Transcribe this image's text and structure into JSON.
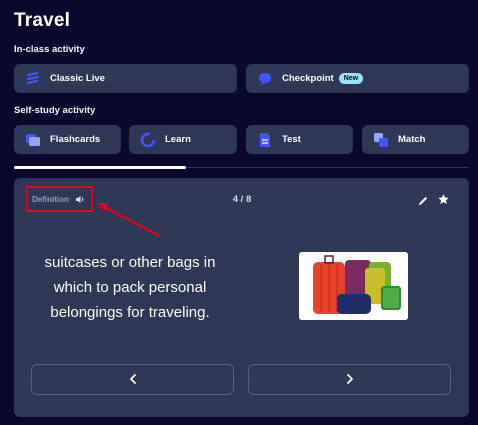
{
  "page": {
    "title": "Travel"
  },
  "sections": {
    "in_class": "In-class activity",
    "self_study": "Self-study activity"
  },
  "in_class_buttons": {
    "classic_live": {
      "label": "Classic Live",
      "icon": "classic-live-icon"
    },
    "checkpoint": {
      "label": "Checkpoint",
      "icon": "checkpoint-icon",
      "badge": "New"
    }
  },
  "self_study_buttons": {
    "flashcards": {
      "label": "Flashcards",
      "icon": "flashcards-icon"
    },
    "learn": {
      "label": "Learn",
      "icon": "learn-icon"
    },
    "test": {
      "label": "Test",
      "icon": "test-icon"
    },
    "match": {
      "label": "Match",
      "icon": "match-icon"
    }
  },
  "card": {
    "side_label": "Definition",
    "counter": "4 / 8",
    "definition": "suitcases or other bags in which to pack personal belongings for traveling.",
    "image_alt": "luggage"
  },
  "colors": {
    "background": "#0a092d",
    "surface": "#2e3856",
    "accent_badge": "#98e3ff",
    "annotation": "#e0001b"
  }
}
